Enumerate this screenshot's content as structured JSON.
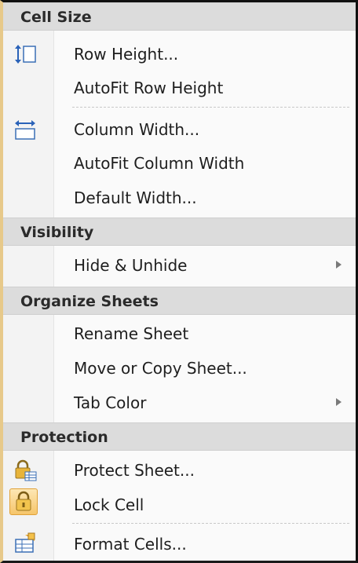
{
  "menu": {
    "sections": [
      {
        "header": "Cell Size",
        "items": [
          {
            "label": "Row Height...",
            "icon": "row-height-icon"
          },
          {
            "label": "AutoFit Row Height"
          },
          {
            "label": "Column Width...",
            "icon": "column-width-icon"
          },
          {
            "label": "AutoFit Column Width"
          },
          {
            "label": "Default Width..."
          }
        ]
      },
      {
        "header": "Visibility",
        "items": [
          {
            "label": "Hide & Unhide",
            "submenu": true
          }
        ]
      },
      {
        "header": "Organize Sheets",
        "items": [
          {
            "label": "Rename Sheet"
          },
          {
            "label": "Move or Copy Sheet..."
          },
          {
            "label": "Tab Color",
            "submenu": true
          }
        ]
      },
      {
        "header": "Protection",
        "items": [
          {
            "label": "Protect Sheet...",
            "icon": "protect-sheet-icon"
          },
          {
            "label": "Lock Cell",
            "icon": "lock-icon",
            "highlighted": true
          },
          {
            "label": "Format Cells...",
            "icon": "format-cells-icon"
          }
        ]
      }
    ]
  },
  "colors": {
    "header_bg": "#dcdcdc",
    "menu_bg": "#fafafa",
    "lock_highlight": "#f6c56a",
    "left_border": "#e7c98a"
  }
}
